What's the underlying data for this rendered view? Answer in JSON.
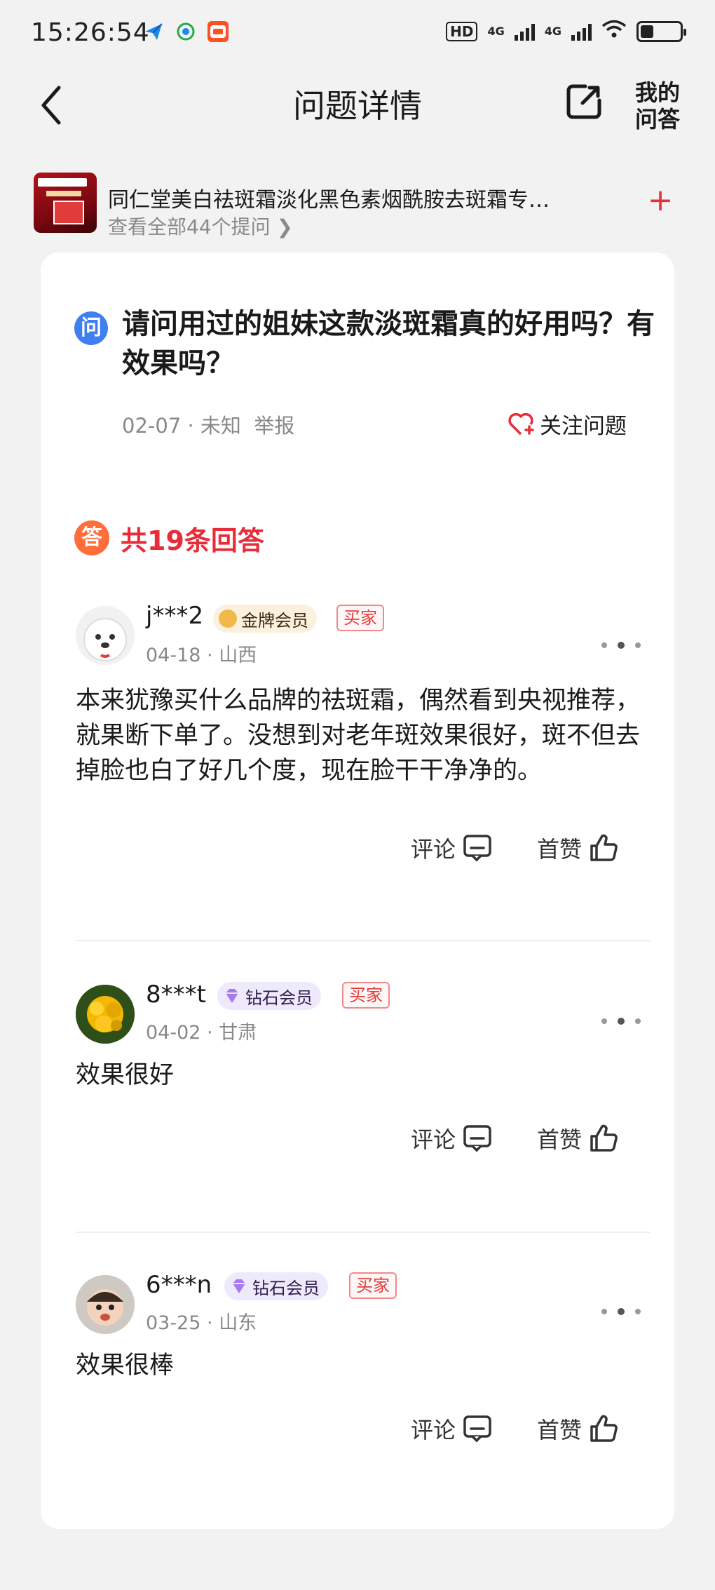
{
  "status_bar": {
    "time": "15:26:54",
    "hd": "HD",
    "hd_sub": "1\n2",
    "net1": "4G",
    "net2": "4G",
    "battery_level": 0.3
  },
  "header": {
    "title": "问题详情",
    "my_qa": "我的\n问答"
  },
  "product": {
    "name": "同仁堂美白祛斑霜淡化黑色素烟酰胺去斑霜专…",
    "sub": "查看全部44个提问 ❯",
    "add": "+"
  },
  "question": {
    "icon": "问",
    "text": "请问用过的姐妹这款淡斑霜真的好用吗？有效果吗？",
    "meta": "02-07 · 未知  举报",
    "follow_label": "关注问题"
  },
  "answers_summary": {
    "icon": "答",
    "count_text": "共19条回答"
  },
  "answers": [
    {
      "user": "j***2",
      "member": "金牌会员",
      "buyer": "买家",
      "meta": "04-18 · 山西",
      "text": "本来犹豫买什么品牌的祛斑霜，偶然看到央视推荐，就果断下单了。没想到对老年斑效果很好，斑不但去掉脸也白了好几个度，现在脸干干净净的。",
      "comment_label": "评论",
      "like_label": "首赞"
    },
    {
      "user": "8***t",
      "member": "钻石会员",
      "buyer": "买家",
      "meta": "04-02 · 甘肃",
      "text": "效果很好",
      "comment_label": "评论",
      "like_label": "首赞"
    },
    {
      "user": "6***n",
      "member": "钻石会员",
      "buyer": "买家",
      "meta": "03-25 · 山东",
      "text": "效果很棒",
      "comment_label": "评论",
      "like_label": "首赞"
    }
  ],
  "colors": {
    "accent_red": "#e82c3a",
    "question_blue": "#3f7ff2",
    "answer_orange": "#ff6e3a"
  }
}
